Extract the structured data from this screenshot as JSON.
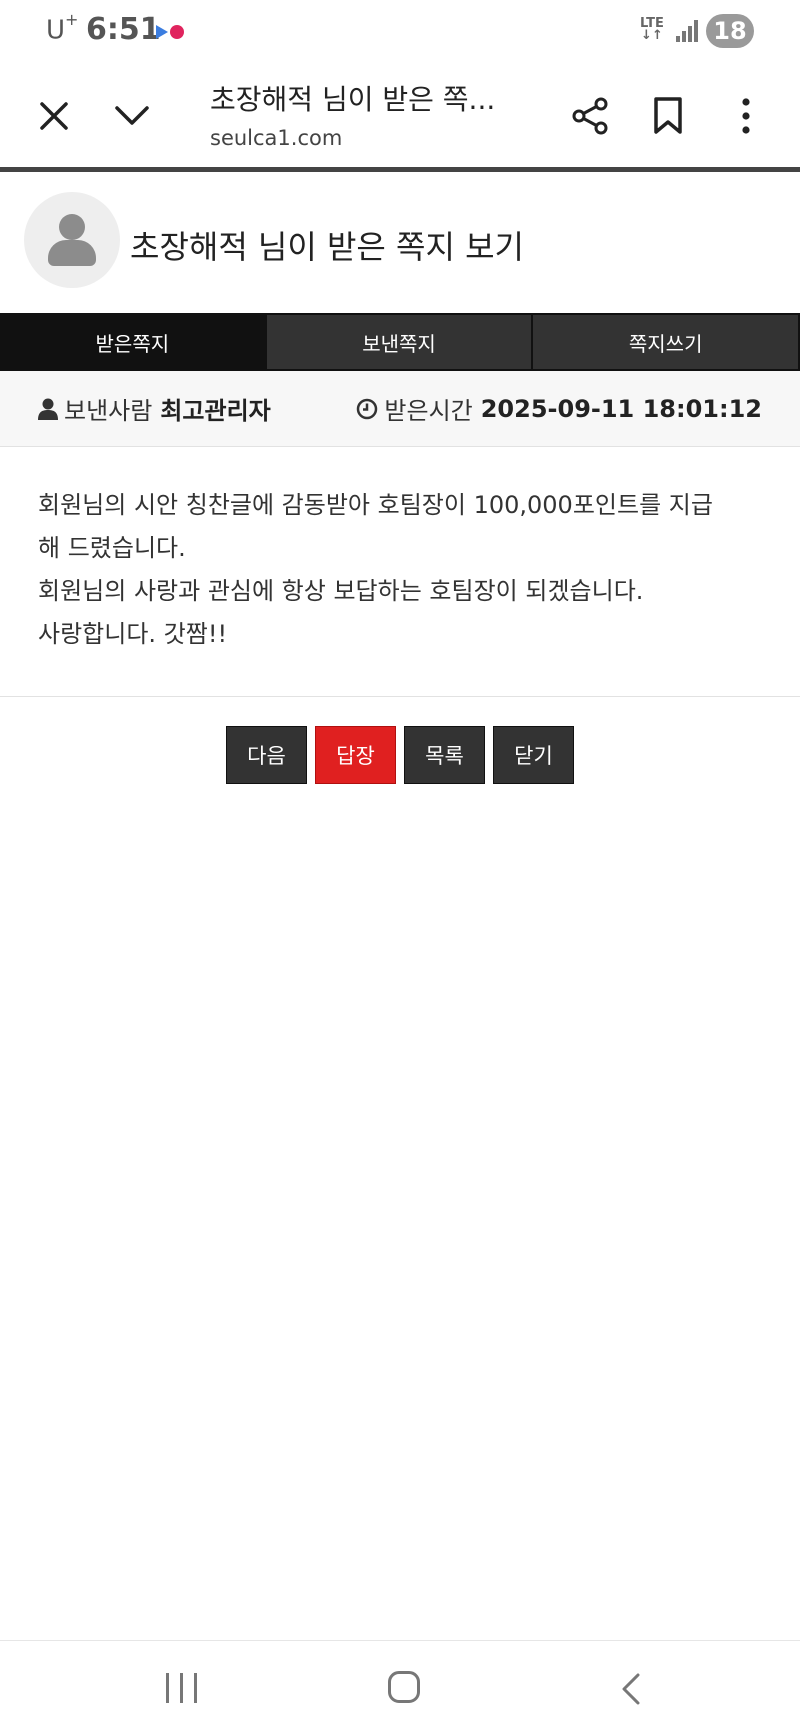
{
  "status_bar": {
    "carrier": "U",
    "carrier_sup": "+",
    "time": "6:51",
    "network": "LTE",
    "battery": "18"
  },
  "browser": {
    "page_title": "초장해적 님이 받은 쪽...",
    "domain": "seulca1.com",
    "icons": [
      "close-icon",
      "chevron-down-icon",
      "share-icon",
      "bookmark-icon",
      "more-vert-icon"
    ]
  },
  "header": {
    "title": "초장해적 님이 받은 쪽지 보기"
  },
  "tabs": [
    {
      "label": "받은쪽지",
      "active": true
    },
    {
      "label": "보낸쪽지",
      "active": false
    },
    {
      "label": "쪽지쓰기",
      "active": false
    }
  ],
  "meta": {
    "sender_label": "보낸사람",
    "sender_name": "최고관리자",
    "received_label": "받은시간",
    "received_time": "2025-09-11 18:01:12"
  },
  "message": {
    "line1": "회원님의 시안 칭찬글에 감동받아 호팀장이 100,000포인트를 지급",
    "line2": "해 드렸습니다.",
    "line3": "회원님의 사랑과 관심에 항상 보답하는 호팀장이 되겠습니다.",
    "line4": "사랑합니다. 갓짬!!"
  },
  "buttons": {
    "next": "다음",
    "reply": "답장",
    "list": "목록",
    "close": "닫기"
  },
  "colors": {
    "reply_button": "#e02020",
    "dark_button": "#333333",
    "active_tab": "#111111"
  }
}
